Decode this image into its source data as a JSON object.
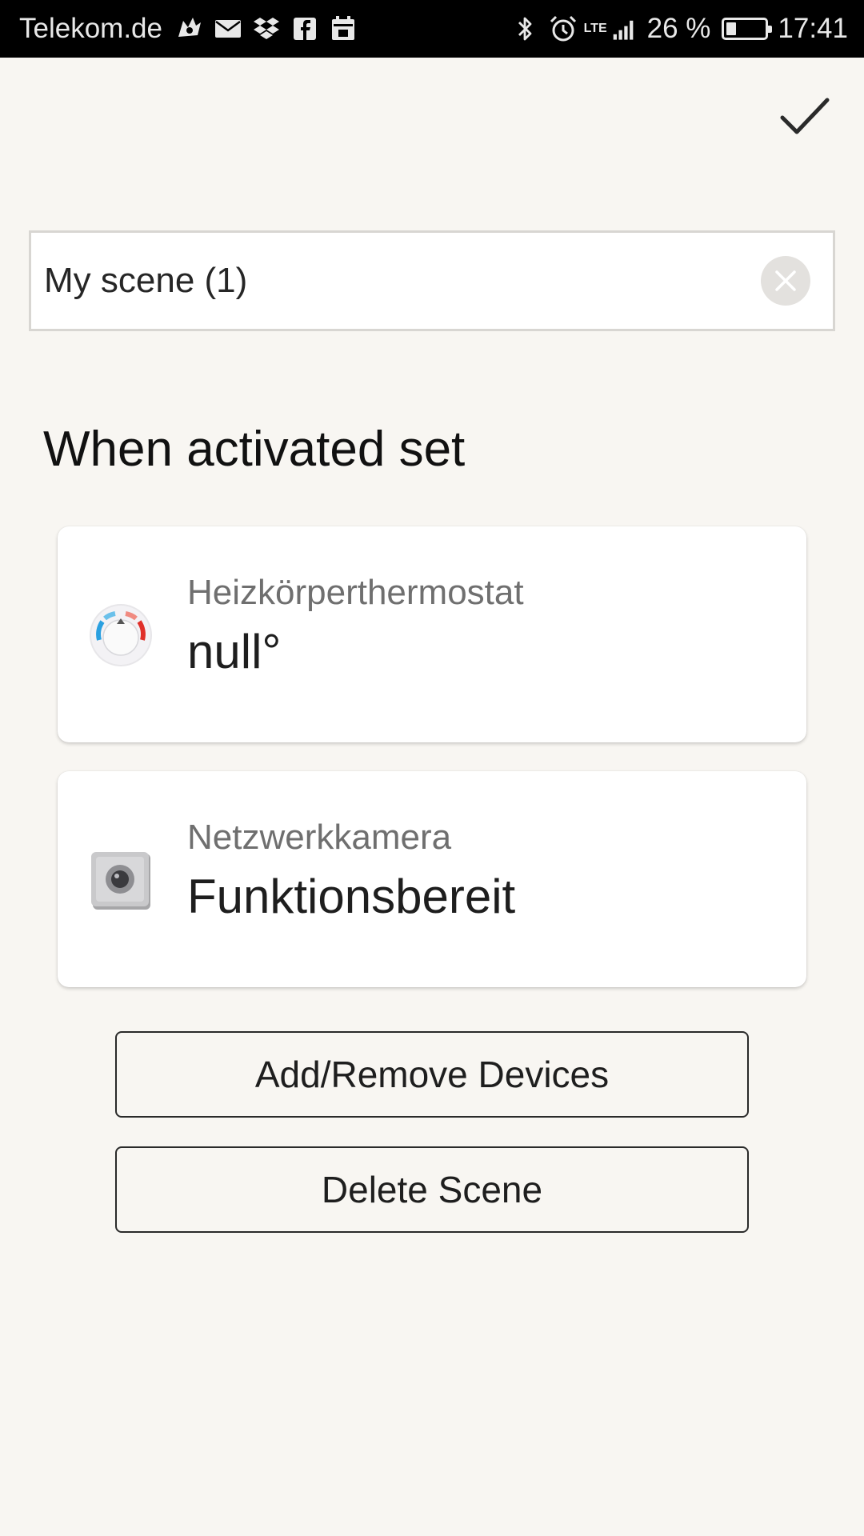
{
  "status_bar": {
    "carrier": "Telekom.de",
    "network": "LTE",
    "battery_percent": "26 %",
    "battery_level": 0.26,
    "time": "17:41",
    "left_icons": [
      "cat-icon",
      "mail-icon",
      "dropbox-icon",
      "facebook-icon",
      "calendar-icon"
    ],
    "right_icons": [
      "bluetooth-icon",
      "alarm-icon",
      "signal-icon",
      "battery-icon"
    ]
  },
  "header": {
    "confirm_icon": "checkmark-icon"
  },
  "scene": {
    "name_value": "My scene (1)",
    "clear_icon": "clear-icon"
  },
  "section": {
    "title": "When activated set"
  },
  "devices": [
    {
      "name": "Heizkörperthermostat",
      "value": "null°",
      "icon": "thermostat-icon"
    },
    {
      "name": "Netzwerkkamera",
      "value": "Funktionsbereit",
      "icon": "camera-icon"
    }
  ],
  "actions": {
    "add_remove_label": "Add/Remove Devices",
    "delete_label": "Delete Scene"
  },
  "colors": {
    "background": "#f8f6f2",
    "status_bar": "#000000",
    "card": "#ffffff",
    "thermostat_blue": "#2aa0e0",
    "thermostat_red": "#e0302a"
  }
}
